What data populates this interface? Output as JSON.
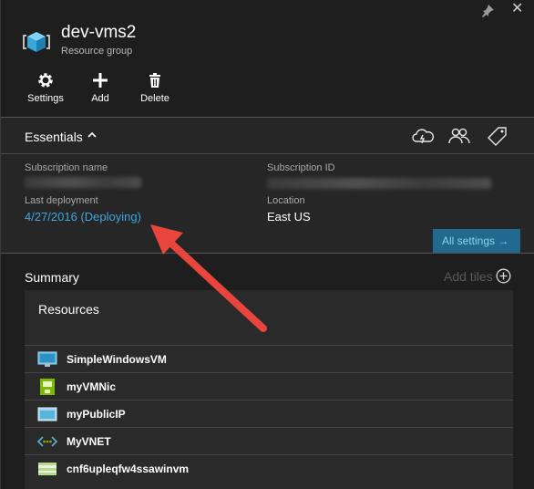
{
  "header": {
    "title": "dev-vms2",
    "subtitle": "Resource group",
    "commands": [
      {
        "label": "Settings",
        "icon": "gear-icon"
      },
      {
        "label": "Add",
        "icon": "plus-icon"
      },
      {
        "label": "Delete",
        "icon": "trash-icon"
      }
    ]
  },
  "essentials": {
    "title": "Essentials",
    "subscription_name_label": "Subscription name",
    "subscription_id_label": "Subscription ID",
    "last_deployment_label": "Last deployment",
    "last_deployment_value": "4/27/2016 (Deploying)",
    "location_label": "Location",
    "location_value": "East US",
    "all_settings_label": "All settings →"
  },
  "summary": {
    "title": "Summary",
    "add_tiles_label": "Add tiles",
    "resources_title": "Resources",
    "resources": [
      {
        "name": "SimpleWindowsVM",
        "icon": "vm-icon"
      },
      {
        "name": "myVMNic",
        "icon": "nic-icon"
      },
      {
        "name": "myPublicIP",
        "icon": "public-ip-icon"
      },
      {
        "name": "MyVNET",
        "icon": "vnet-icon"
      },
      {
        "name": "cnf6upleqfw4ssawinvm",
        "icon": "storage-icon"
      }
    ]
  },
  "colors": {
    "link": "#3ea5e0",
    "accent_button": "#1f6a8e",
    "annotation_arrow": "#e8453c"
  }
}
